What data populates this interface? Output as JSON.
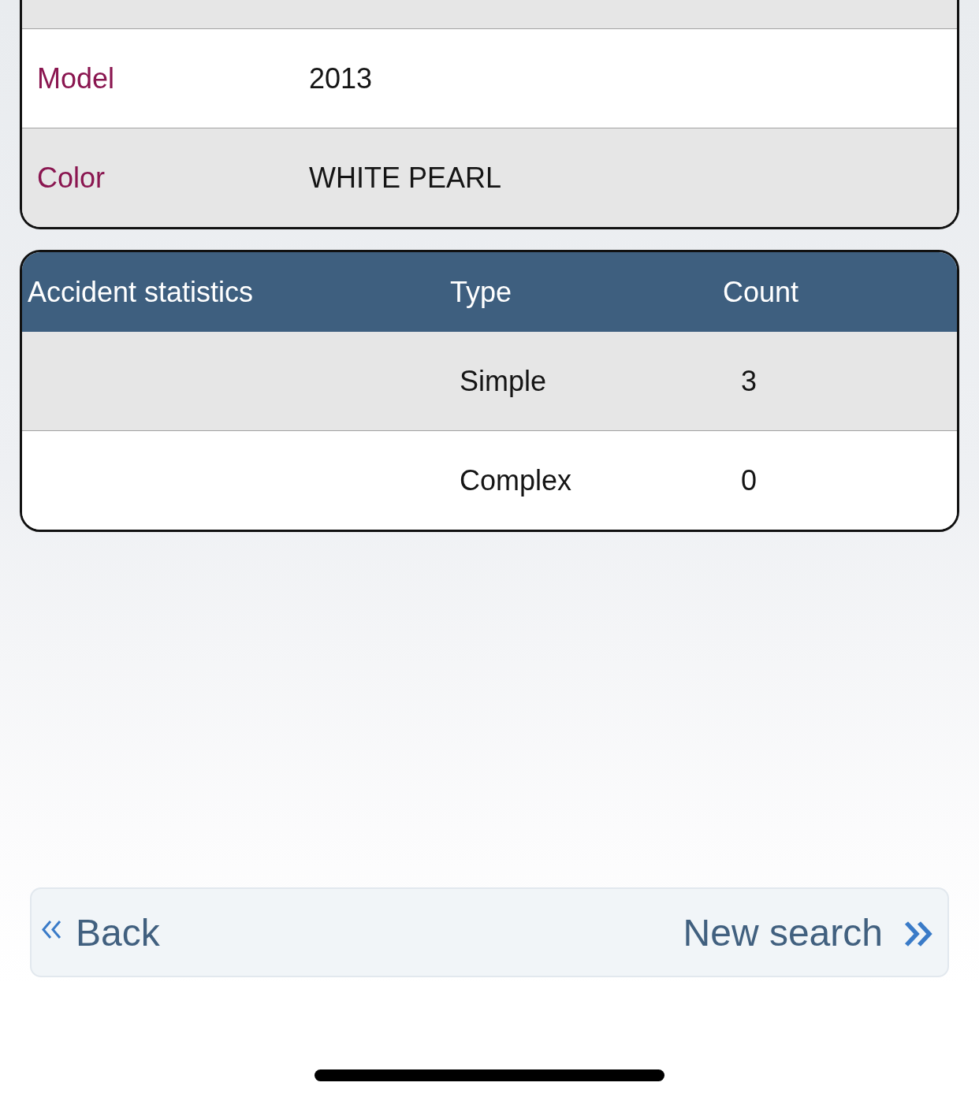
{
  "details": {
    "rows": [
      {
        "label": "Model",
        "value": "2013"
      },
      {
        "label": "Color",
        "value": "WHITE PEARL"
      }
    ]
  },
  "accident_statistics": {
    "columns": [
      "Accident statistics",
      "Type",
      "Count"
    ],
    "rows": [
      {
        "type": "Simple",
        "count": "3"
      },
      {
        "type": "Complex",
        "count": "0"
      }
    ]
  },
  "navigation": {
    "back": "Back",
    "next": "New search"
  }
}
